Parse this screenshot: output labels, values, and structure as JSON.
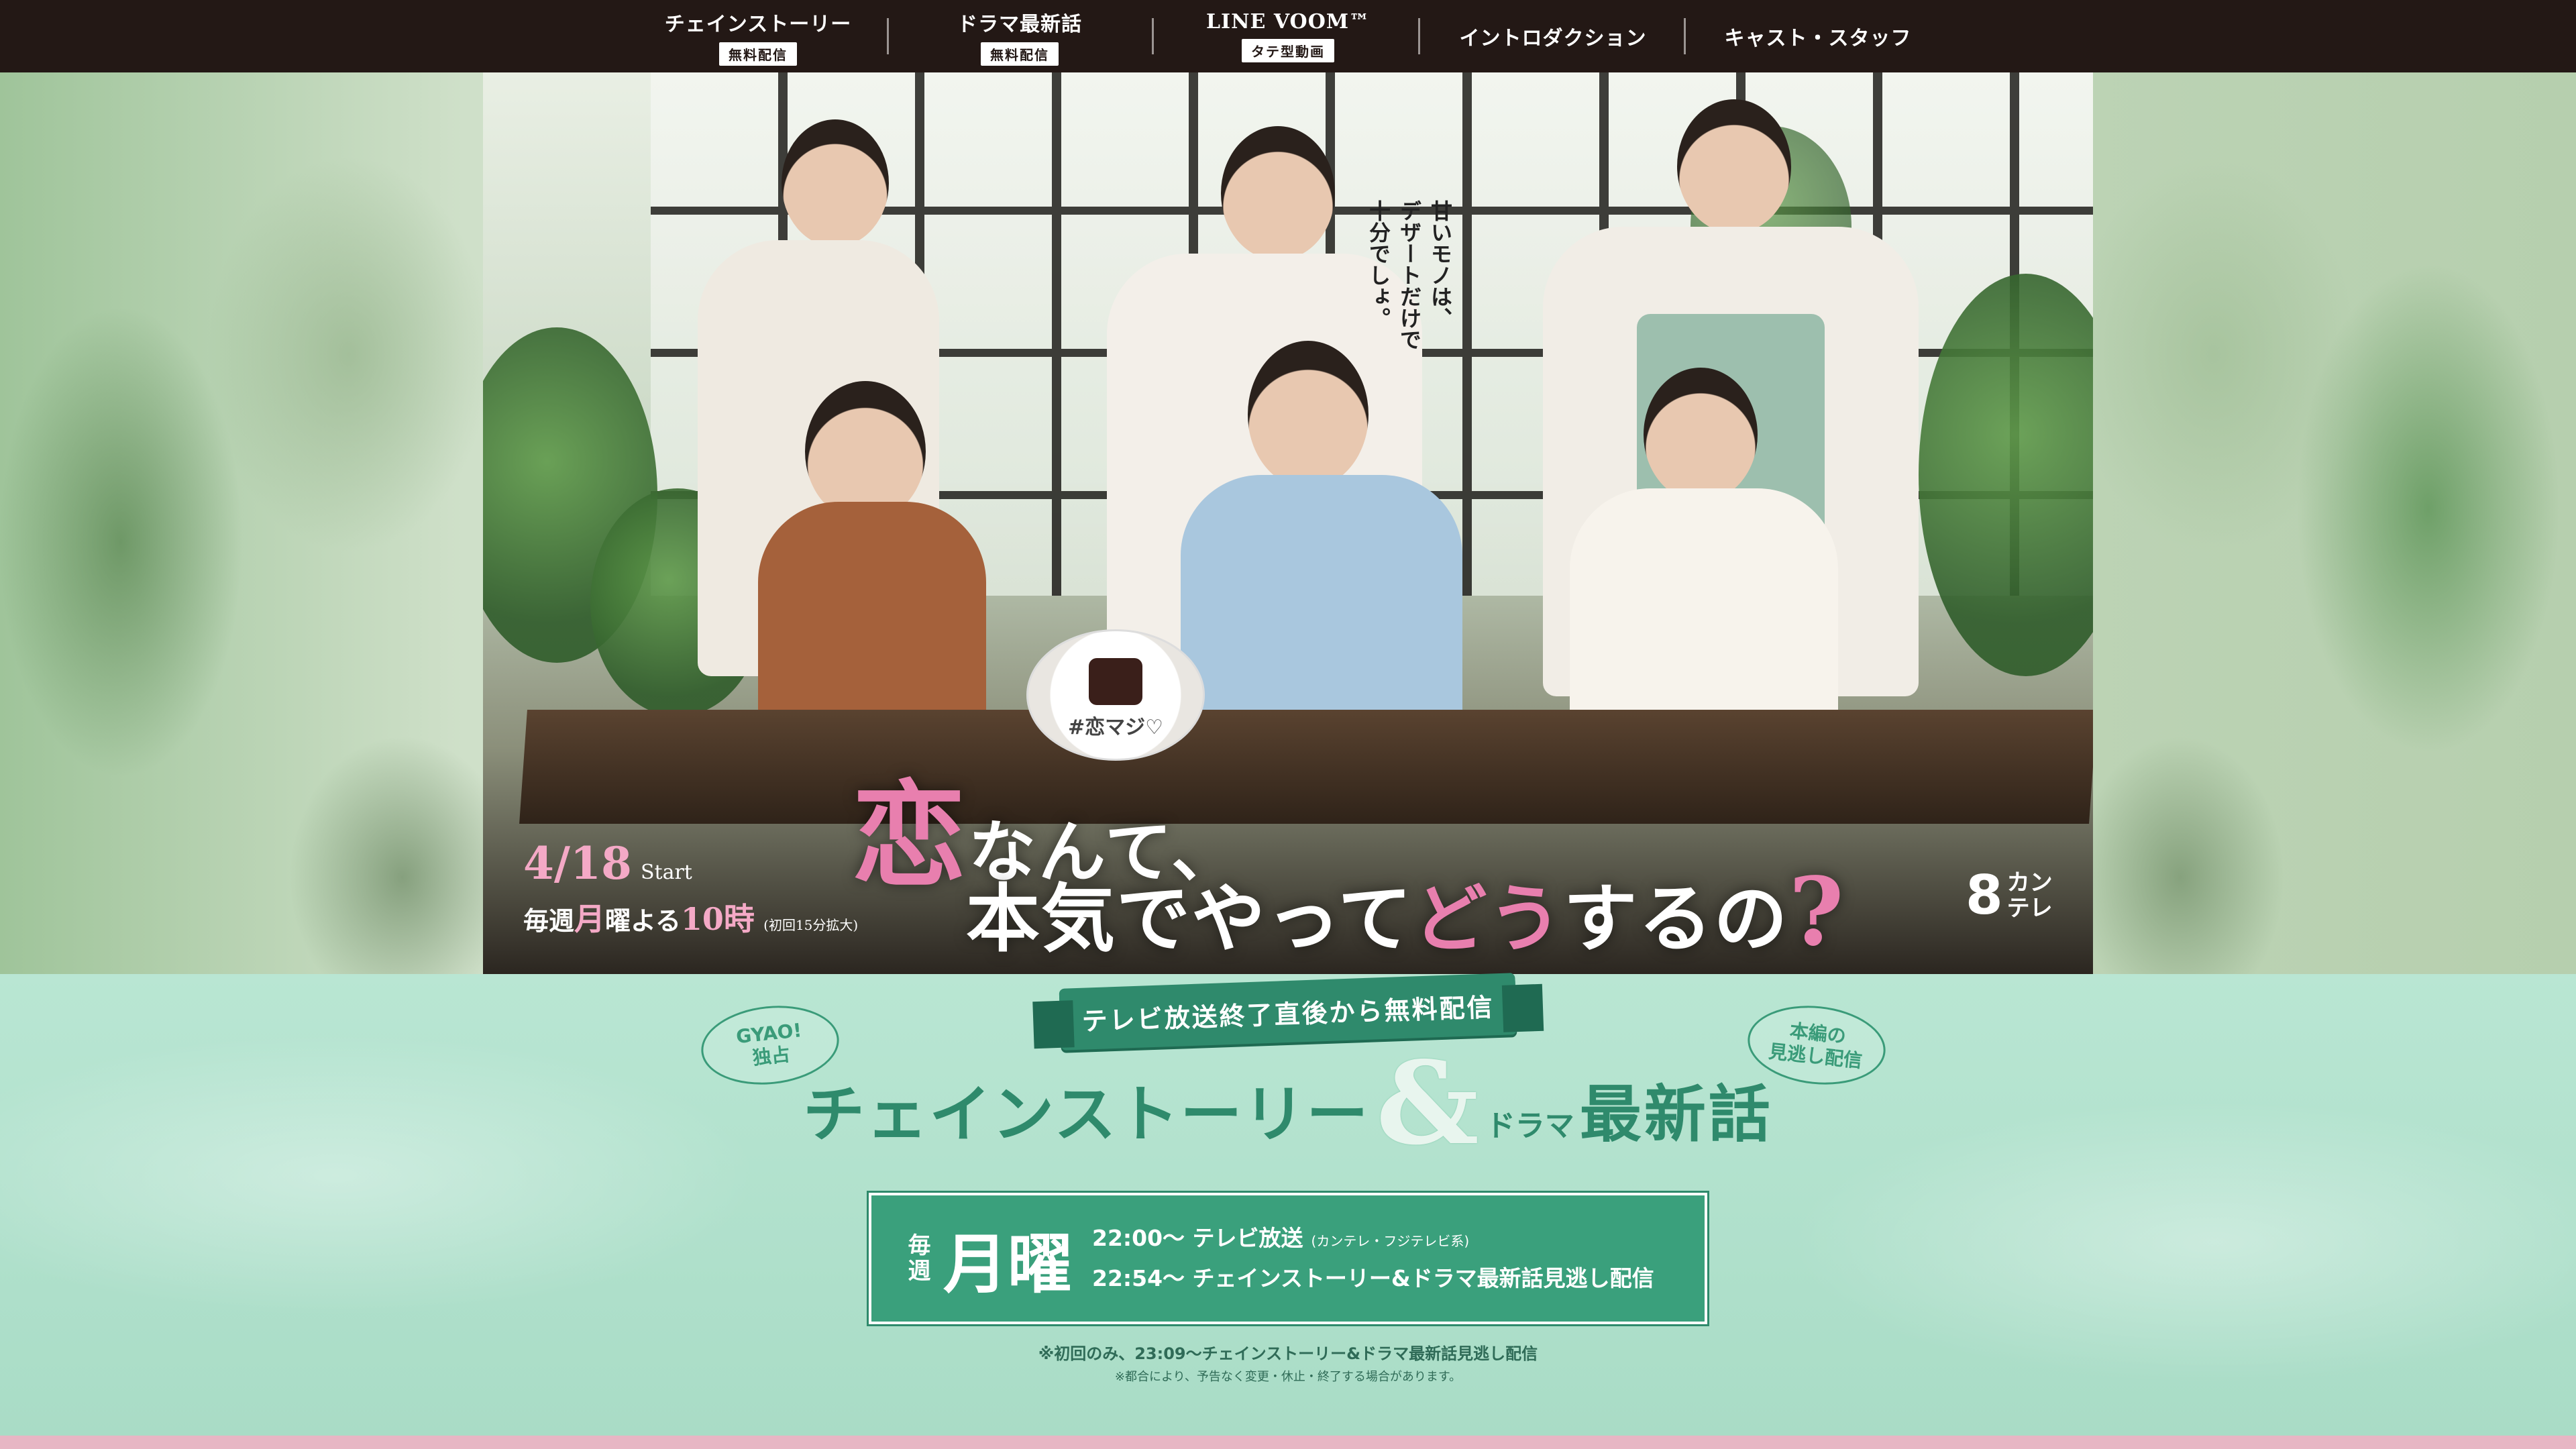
{
  "nav": {
    "items": [
      {
        "label": "チェインストーリー",
        "sub": "無料配信"
      },
      {
        "label": "ドラマ最新話",
        "sub": "無料配信"
      },
      {
        "label": "LINE VOOM™",
        "sub": "タテ型動画"
      },
      {
        "label": "イントロダクション",
        "sub": ""
      },
      {
        "label": "キャスト・スタッフ",
        "sub": ""
      }
    ]
  },
  "hero": {
    "tagline": "甘いモノは、\nデザートだけで\n十分でしょ。",
    "plate_text": "#恋マジ♡",
    "date": "4/18",
    "start": "Start",
    "schedule_prefix": "毎週",
    "schedule_day": "月",
    "schedule_mid": "曜よる",
    "schedule_time": "10時",
    "schedule_note": "(初回15分拡大)",
    "title_koi": "恋",
    "title_line1": "なんて、",
    "title_line2_a": "本気でやって",
    "title_line2_pink": "どう",
    "title_line2_b": "するの",
    "title_q": "?",
    "logo_number": "8",
    "logo_text_top": "カン",
    "logo_text_bottom": "テレ"
  },
  "promo": {
    "ribbon": "テレビ放送終了直後から無料配信",
    "bubble_left_line1": "GYAO!",
    "bubble_left_line2": "独占",
    "bubble_right_line1": "本編の",
    "bubble_right_line2": "見逃し配信",
    "heading_chain": "チェインストーリー",
    "heading_amp": "&",
    "heading_drama": "ドラマ",
    "heading_latest": "最新話"
  },
  "schedule": {
    "every": "毎週",
    "day": "月曜",
    "line1": "22:00〜 テレビ放送",
    "line1_note": "(カンテレ・フジテレビ系)",
    "line2": "22:54〜 チェインストーリー&ドラマ最新話見逃し配信"
  },
  "notices": {
    "first": "※初回のみ、23:09〜チェインストーリー&ドラマ最新話見逃し配信",
    "second": "※都合により、予告なく変更・休止・終了する場合があります。"
  },
  "colors": {
    "nav_bg": "#231815",
    "accent_green": "#3aa07c",
    "pink": "#e87fae",
    "mint": "#b9e6d3"
  }
}
